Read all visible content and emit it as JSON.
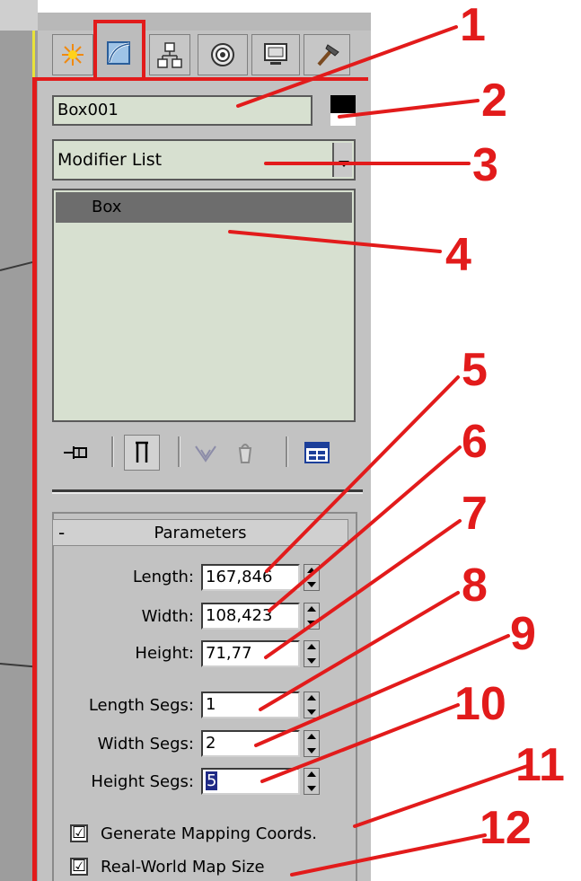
{
  "object_name": "Box001",
  "object_color": "#000000",
  "modifier_list": {
    "label": "Modifier List"
  },
  "stack": {
    "items": [
      "Box"
    ]
  },
  "rollout": {
    "collapse_symbol": "-",
    "title": "Parameters",
    "params": [
      {
        "label": "Length:",
        "value": "167,846"
      },
      {
        "label": "Width:",
        "value": "108,423"
      },
      {
        "label": "Height:",
        "value": "71,77"
      },
      {
        "label": "Length Segs:",
        "value": "1"
      },
      {
        "label": "Width Segs:",
        "value": "2"
      },
      {
        "label": "Height Segs:",
        "value": "5"
      }
    ],
    "checkboxes": [
      {
        "label": "Generate Mapping Coords.",
        "checked": true,
        "mark": "☑"
      },
      {
        "label": "Real-World Map Size",
        "checked": true,
        "mark": "☑"
      }
    ]
  },
  "tabs": [
    "create-icon",
    "modify-icon",
    "hierarchy-icon",
    "motion-icon",
    "display-icon",
    "utilities-icon"
  ],
  "toolbar": [
    "pin-stack-icon",
    "show-end-result-icon",
    "make-unique-icon",
    "remove-modifier-icon",
    "configure-modifier-sets-icon"
  ],
  "annotations": [
    "1",
    "2",
    "3",
    "4",
    "5",
    "6",
    "7",
    "8",
    "9",
    "10",
    "11",
    "12"
  ],
  "colors": {
    "annotation": "#e21b1b",
    "field_bg": "#d7e0d0",
    "panel_bg": "#c2c2c2",
    "stack_selected": "#6d6d6d"
  }
}
